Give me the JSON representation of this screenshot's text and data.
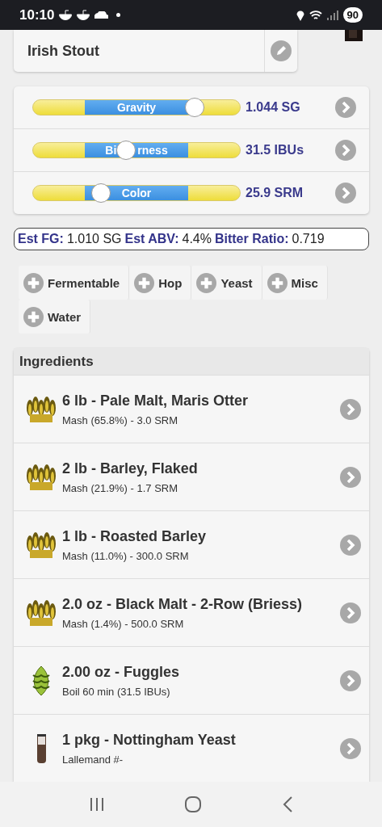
{
  "status_bar": {
    "time": "10:10",
    "battery": "90"
  },
  "recipe": {
    "name": "Irish Stout"
  },
  "sliders": [
    {
      "label": [
        "Gravity"
      ],
      "level": 0.78,
      "reading": "1.044 SG"
    },
    {
      "label": [
        "Bi",
        "rness"
      ],
      "level": 0.45,
      "reading": "31.5 IBUs"
    },
    {
      "label": [
        "Color"
      ],
      "level": 0.33,
      "reading": "25.9 SRM"
    }
  ],
  "stats": [
    {
      "label": "Est FG:",
      "value": "1.010 SG"
    },
    {
      "label": "Est ABV:",
      "value": "4.4%"
    },
    {
      "label": "Bitter Ratio:",
      "value": "0.719"
    }
  ],
  "add_buttons": [
    "Fermentable",
    "Hop",
    "Yeast",
    "Misc",
    "Water"
  ],
  "ingredients": {
    "title": "Ingredients",
    "items": [
      {
        "kind": "grain",
        "name": "6 lb - Pale Malt, Maris Otter",
        "detail": "Mash (65.8%) - 3.0 SRM"
      },
      {
        "kind": "grain",
        "name": "2 lb - Barley, Flaked",
        "detail": "Mash (21.9%) - 1.7 SRM"
      },
      {
        "kind": "grain",
        "name": "1 lb - Roasted Barley",
        "detail": "Mash (11.0%) - 300.0 SRM"
      },
      {
        "kind": "grain",
        "name": "2.0 oz - Black Malt - 2-Row (Briess)",
        "detail": "Mash (1.4%) - 500.0 SRM"
      },
      {
        "kind": "hop",
        "name": "2.00 oz - Fuggles",
        "detail": "Boil 60 min (31.5 IBUs)"
      },
      {
        "kind": "yeast",
        "name": "1 pkg - Nottingham Yeast",
        "detail": "Lallemand #-"
      }
    ]
  }
}
